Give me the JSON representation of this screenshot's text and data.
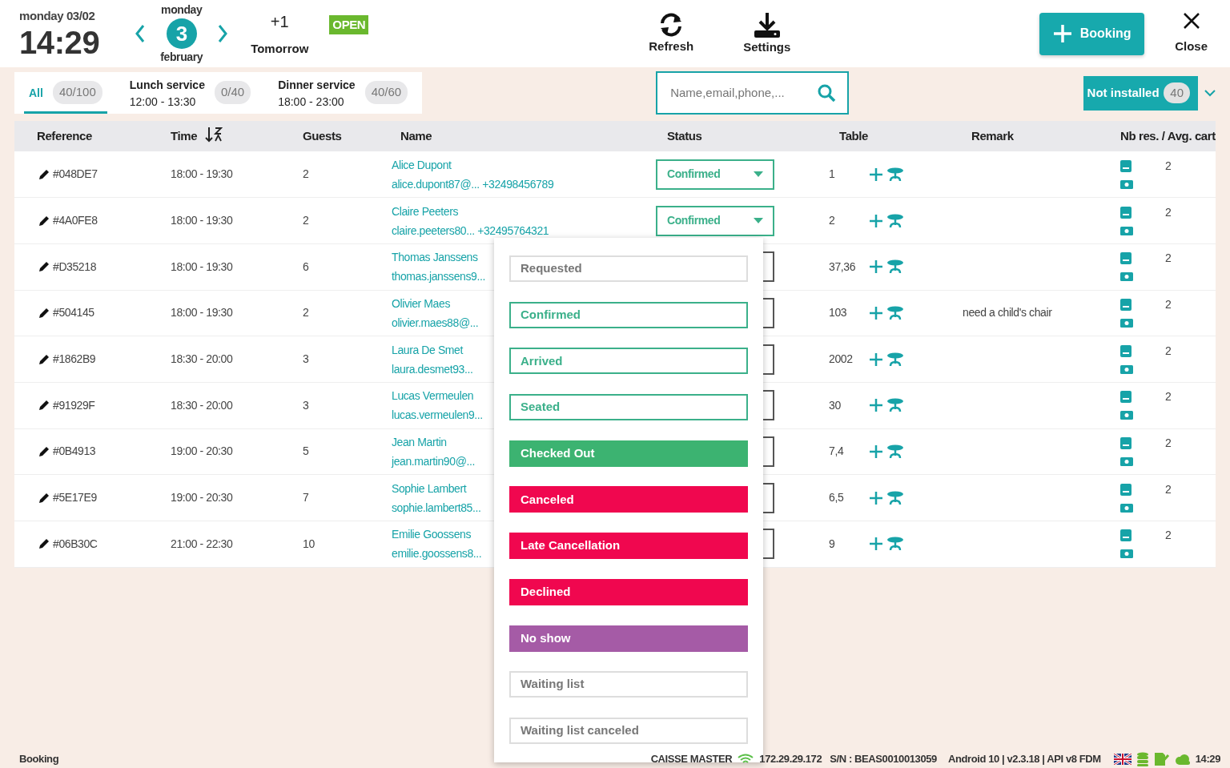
{
  "header": {
    "date": "monday 03/02",
    "time": "14:29",
    "day_name": "monday",
    "day_number": "3",
    "month": "february",
    "next_day": "+1",
    "next_day_label": "Tomorrow",
    "open_badge": "OPEN",
    "refresh": "Refresh",
    "settings": "Settings",
    "booking_button": "Booking",
    "close": "Close"
  },
  "services": [
    {
      "label": "All",
      "count": "40/100",
      "selected": true
    },
    {
      "label": "Lunch service",
      "hours": "12:00 - 13:30",
      "count": "0/40",
      "selected": false
    },
    {
      "label": "Dinner service",
      "hours": "18:00 - 23:00",
      "count": "40/60",
      "selected": false
    }
  ],
  "search": {
    "placeholder": "Name,email,phone,..."
  },
  "filter": {
    "label": "Not installed",
    "count": "40"
  },
  "table": {
    "columns": [
      "Reference",
      "Time",
      "Guests",
      "Name",
      "Status",
      "Table",
      "Remark",
      "Nb res. / Avg. cart"
    ],
    "rows": [
      {
        "reference": "#048DE7",
        "time": "18:00 - 19:30",
        "guests": "2",
        "name": "Alice Dupont",
        "contact": "alice.dupont87@... +32498456789",
        "status": "Confirmed",
        "table": "1",
        "nb_res": "2"
      },
      {
        "reference": "#4A0FE8",
        "time": "18:00 - 19:30",
        "guests": "2",
        "name": "Claire Peeters",
        "contact": "claire.peeters80...  +32495764321",
        "status": "Confirmed",
        "table": "2",
        "nb_res": "2"
      },
      {
        "reference": "#D35218",
        "time": "18:00 - 19:30",
        "guests": "6",
        "name": "Thomas Janssens",
        "contact": "thomas.janssens9...",
        "table": "37,36",
        "nb_res": "2"
      },
      {
        "reference": "#504145",
        "time": "18:00 - 19:30",
        "guests": "2",
        "name": "Olivier Maes",
        "contact": "olivier.maes88@...",
        "table": "103",
        "remark": "need a child's chair",
        "nb_res": "2"
      },
      {
        "reference": "#1862B9",
        "time": "18:30 - 20:00",
        "guests": "3",
        "name": "Laura De Smet",
        "contact": "laura.desmet93...",
        "table": "2002",
        "nb_res": "2"
      },
      {
        "reference": "#91929F",
        "time": "18:30 - 20:00",
        "guests": "3",
        "name": "Lucas Vermeulen",
        "contact": "lucas.vermeulen9...",
        "table": "30",
        "nb_res": "2"
      },
      {
        "reference": "#0B4913",
        "time": "19:00 - 20:30",
        "guests": "5",
        "name": "Jean Martin",
        "contact": "jean.martin90@...",
        "table": "7,4",
        "nb_res": "2"
      },
      {
        "reference": "#5E17E9",
        "time": "19:00 - 20:30",
        "guests": "7",
        "name": "Sophie Lambert",
        "contact": "sophie.lambert85...",
        "table": "6,5",
        "nb_res": "2"
      },
      {
        "reference": "#06B30C",
        "time": "21:00 - 22:30",
        "guests": "10",
        "name": "Emilie Goossens",
        "contact": "emilie.goossens8...",
        "table": "9",
        "nb_res": "2"
      }
    ]
  },
  "status_menu": [
    {
      "label": "Requested",
      "kind": "outline",
      "color": "#dddddd"
    },
    {
      "label": "Confirmed",
      "kind": "outline",
      "color": "#3bb08a"
    },
    {
      "label": "Arrived",
      "kind": "outline",
      "color": "#3bb08a"
    },
    {
      "label": "Seated",
      "kind": "outline",
      "color": "#3bb08a"
    },
    {
      "label": "Checked Out",
      "kind": "filled",
      "color": "#3cb371"
    },
    {
      "label": "Canceled",
      "kind": "filled",
      "color": "#f0074f"
    },
    {
      "label": "Late Cancellation",
      "kind": "filled",
      "color": "#f0074f"
    },
    {
      "label": "Declined",
      "kind": "filled",
      "color": "#f0074f"
    },
    {
      "label": "No show",
      "kind": "filled",
      "color": "#a55ba6"
    },
    {
      "label": "Waiting list",
      "kind": "outline",
      "color": "#dddddd"
    },
    {
      "label": "Waiting list canceled",
      "kind": "outline",
      "color": "#dddddd"
    }
  ],
  "status_bar": {
    "page": "Booking",
    "device": "CAISSE MASTER",
    "ip": "172.29.29.172",
    "serial": "S/N : BEAS0010013059",
    "system": "Android 10  |  v2.3.18 | API v8 FDM",
    "time": "14:29"
  }
}
